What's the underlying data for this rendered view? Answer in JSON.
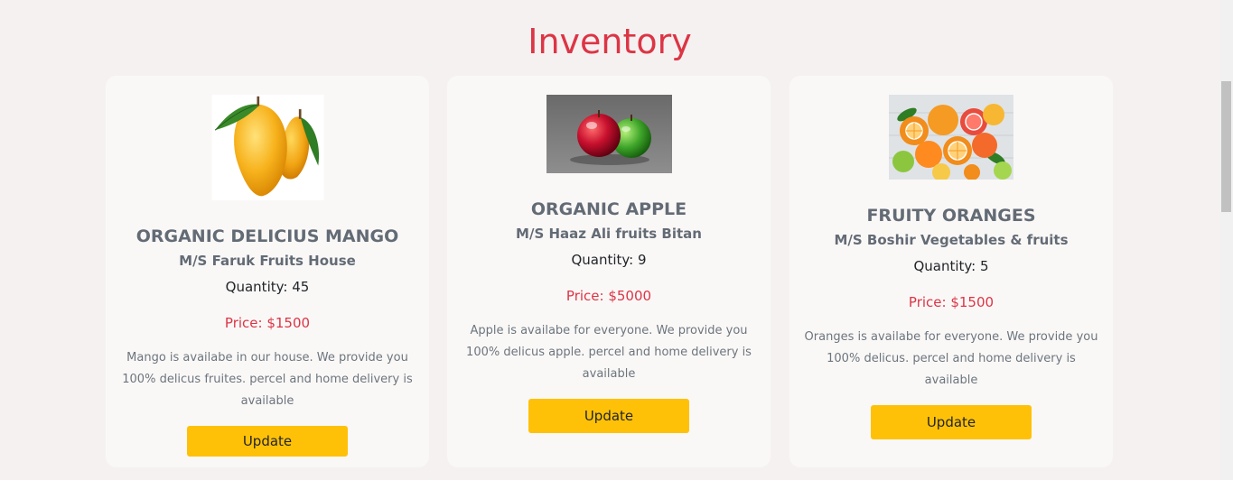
{
  "page": {
    "title": "Inventory"
  },
  "colors": {
    "accent": "#dc3545",
    "button": "#ffc107",
    "card": "#faf8f7",
    "background": "#f5f1f1"
  },
  "products": [
    {
      "name": "ORGANIC DELICIUS MANGO",
      "supplier": "M/S Faruk Fruits House",
      "quantity": "Quantity: 45",
      "price": "Price: $1500",
      "description": "Mango is availabe in our house. We provide you 100% delicus fruites. percel and home delivery is available",
      "button_label": "Update",
      "image": "mango-image"
    },
    {
      "name": "ORGANIC APPLE",
      "supplier": "M/S Haaz Ali fruits Bitan",
      "quantity": "Quantity: 9",
      "price": "Price: $5000",
      "description": "Apple is availabe for everyone. We provide you 100% delicus apple. percel and home delivery is available",
      "button_label": "Update",
      "image": "apple-image"
    },
    {
      "name": "FRUITY ORANGES",
      "supplier": "M/S Boshir Vegetables & fruits",
      "quantity": "Quantity: 5",
      "price": "Price: $1500",
      "description": "Oranges is availabe for everyone. We provide you 100% delicus. percel and home delivery is available",
      "button_label": "Update",
      "image": "oranges-image"
    }
  ]
}
